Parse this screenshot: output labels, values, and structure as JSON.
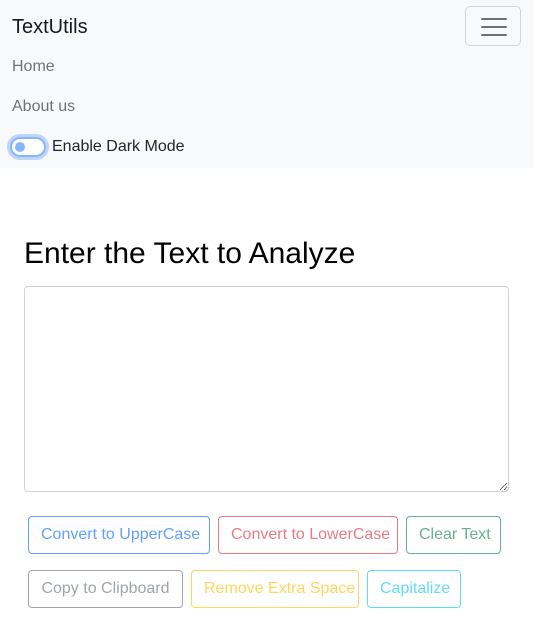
{
  "navbar": {
    "brand": "TextUtils",
    "links": [
      {
        "label": "Home"
      },
      {
        "label": "About us"
      }
    ],
    "dark_mode": {
      "label": "Enable Dark Mode",
      "enabled": false
    },
    "toggler_icon": "hamburger-menu-icon"
  },
  "main": {
    "heading": "Enter the Text to Analyze",
    "textarea": {
      "value": "",
      "placeholder": ""
    },
    "buttons": [
      {
        "label": "Convert to UpperCase",
        "color": "#0d6efd"
      },
      {
        "label": "Convert to LowerCase",
        "color": "#dc3545"
      },
      {
        "label": "Clear Text",
        "color": "#198754"
      },
      {
        "label": "Copy to Clipboard",
        "color": "#6c757d"
      },
      {
        "label": "Remove Extra Space",
        "color": "#ffc107"
      },
      {
        "label": "Capitalize",
        "color": "#0dcaf0"
      }
    ]
  }
}
